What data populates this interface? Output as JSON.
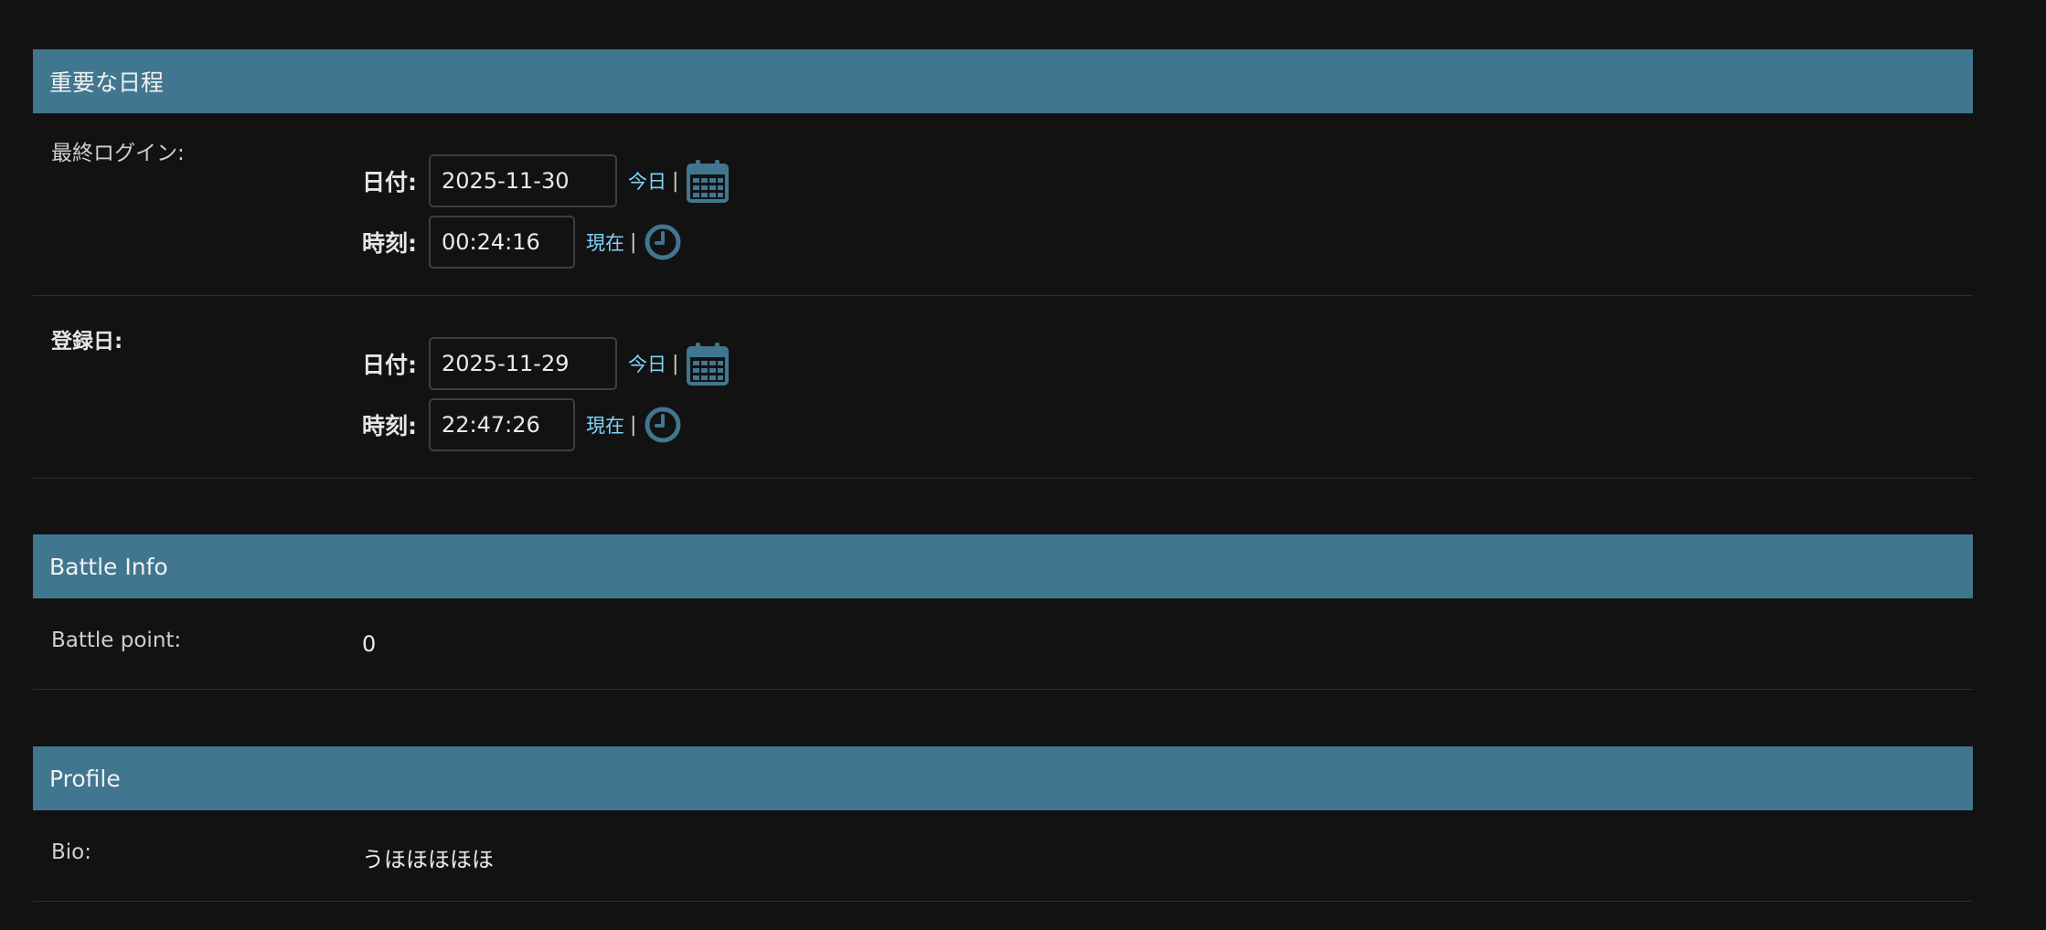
{
  "sections": {
    "dates": {
      "title": "重要な日程",
      "last_login": {
        "label": "最終ログイン:",
        "date_caption": "日付:",
        "date_value": "2025-11-30",
        "today_link": "今日",
        "separator": "|",
        "time_caption": "時刻:",
        "time_value": "00:24:16",
        "now_link": "現在"
      },
      "date_joined": {
        "label": "登録日:",
        "date_caption": "日付:",
        "date_value": "2025-11-29",
        "today_link": "今日",
        "separator": "|",
        "time_caption": "時刻:",
        "time_value": "22:47:26",
        "now_link": "現在"
      }
    },
    "battle": {
      "title": "Battle Info",
      "battle_point_label": "Battle point:",
      "battle_point_value": "0"
    },
    "profile": {
      "title": "Profile",
      "bio_label": "Bio:",
      "bio_value": "うほほほほほ"
    }
  },
  "colors": {
    "background": "#121212",
    "header": "#417690",
    "link": "#81d4fa",
    "icon": "#417690"
  },
  "icons": [
    "calendar-icon",
    "clock-icon"
  ]
}
